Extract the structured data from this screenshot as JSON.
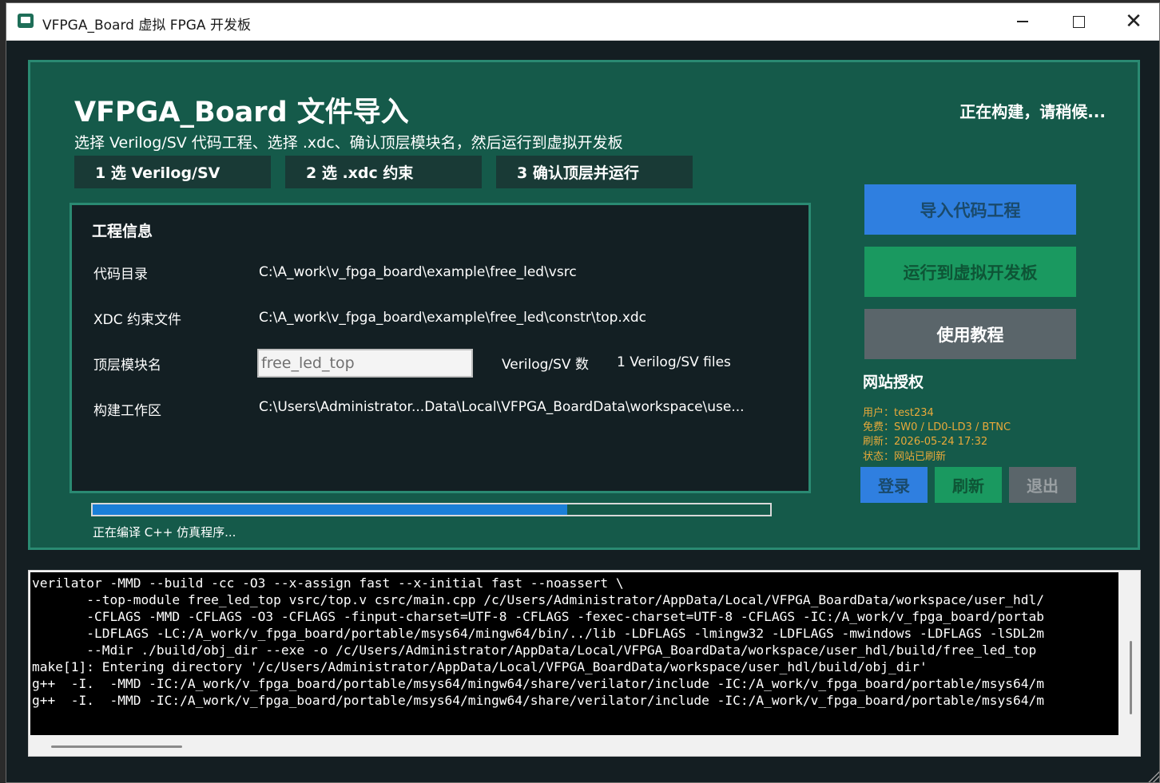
{
  "window": {
    "title": "VFPGA_Board 虚拟 FPGA 开发板",
    "minimize_label": "",
    "close_label": "✕"
  },
  "header": {
    "title": "VFPGA_Board 文件导入",
    "subtitle": "选择 Verilog/SV 代码工程、选择 .xdc、确认顶层模块名，然后运行到虚拟开发板",
    "status": "正在构建，请稍候..."
  },
  "steps": [
    {
      "label": "1  选 Verilog/SV"
    },
    {
      "label": "2  选 .xdc 约束"
    },
    {
      "label": "3  确认顶层并运行"
    }
  ],
  "project_info": {
    "heading": "工程信息",
    "code_dir_label": "代码目录",
    "code_dir_value": "C:\\A_work\\v_fpga_board\\example\\free_led\\vsrc",
    "xdc_label": "XDC 约束文件",
    "xdc_value": "C:\\A_work\\v_fpga_board\\example\\free_led\\constr\\top.xdc",
    "top_label": "顶层模块名",
    "top_value": "free_led_top",
    "vcount_label": "Verilog/SV 数",
    "vcount_value": "1 Verilog/SV files",
    "workspace_label": "构建工作区",
    "workspace_value": "C:\\Users\\Administrator...Data\\Local\\VFPGA_BoardData\\workspace\\use..."
  },
  "progress": {
    "fraction": 0.7,
    "text": "正在编译 C++ 仿真程序..."
  },
  "actions": {
    "import_label": "导入代码工程",
    "run_label": "运行到虚拟开发板",
    "tutorial_label": "使用教程"
  },
  "auth": {
    "title": "网站授权",
    "user": "用户：test234",
    "free": "免费：SW0 / LD0-LD3 / BTNC",
    "refresh_time": "刷新：2026-05-24 17:32",
    "state": "状态：网站已刷新",
    "login_label": "登录",
    "refresh_label": "刷新",
    "logout_label": "退出"
  },
  "console": {
    "lines": [
      "verilator -MMD --build -cc -O3 --x-assign fast --x-initial fast --noassert \\",
      "       --top-module free_led_top vsrc/top.v csrc/main.cpp /c/Users/Administrator/AppData/Local/VFPGA_BoardData/workspace/user_hdl/",
      "       -CFLAGS -MMD -CFLAGS -O3 -CFLAGS -finput-charset=UTF-8 -CFLAGS -fexec-charset=UTF-8 -CFLAGS -IC:/A_work/v_fpga_board/portab",
      "       -LDFLAGS -LC:/A_work/v_fpga_board/portable/msys64/mingw64/bin/../lib -LDFLAGS -lmingw32 -LDFLAGS -mwindows -LDFLAGS -lSDL2m",
      "       --Mdir ./build/obj_dir --exe -o /c/Users/Administrator/AppData/Local/VFPGA_BoardData/workspace/user_hdl/build/free_led_top",
      "make[1]: Entering directory '/c/Users/Administrator/AppData/Local/VFPGA_BoardData/workspace/user_hdl/build/obj_dir'",
      "g++  -I.  -MMD -IC:/A_work/v_fpga_board/portable/msys64/mingw64/share/verilator/include -IC:/A_work/v_fpga_board/portable/msys64/m",
      "g++  -I.  -MMD -IC:/A_work/v_fpga_board/portable/msys64/mingw64/share/verilator/include -IC:/A_work/v_fpga_board/portable/msys64/m"
    ]
  }
}
